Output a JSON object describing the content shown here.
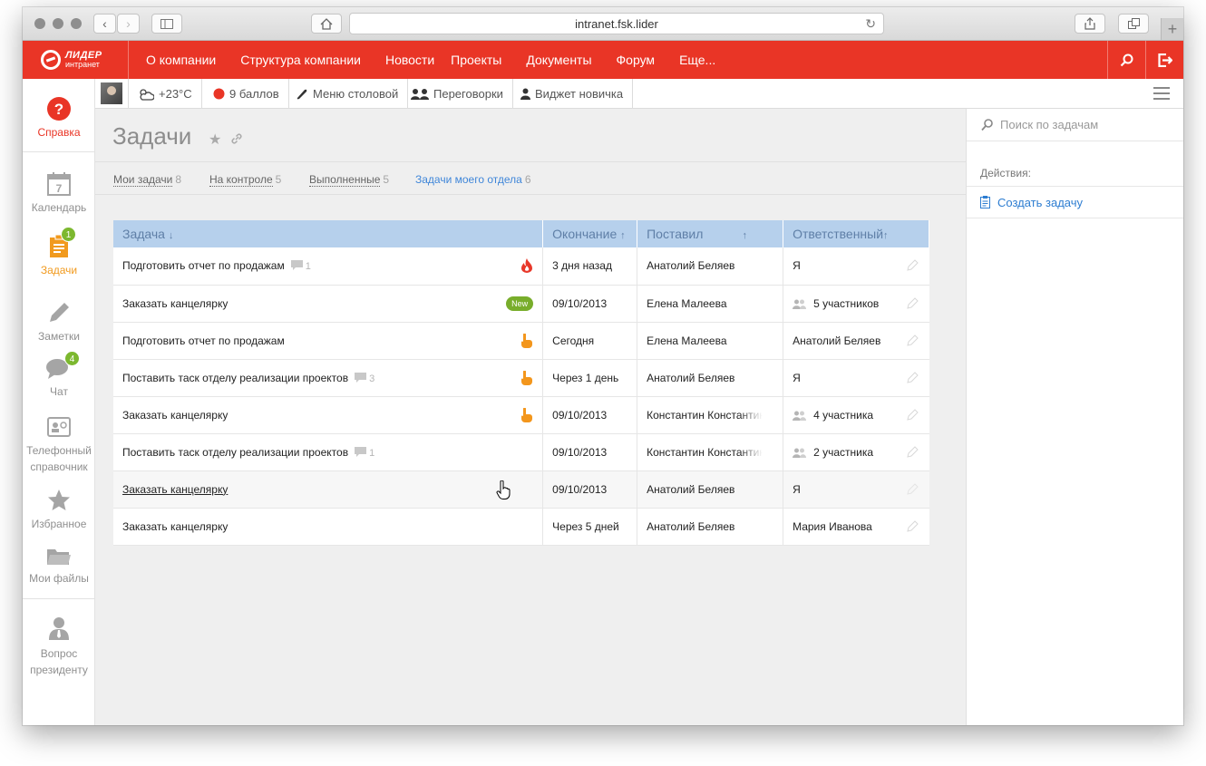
{
  "browser": {
    "url": "intranet.fsk.lider"
  },
  "brand": {
    "name": "ЛИДЕР",
    "subtitle": "интранет",
    "accent_color": "#e93526"
  },
  "topnav": {
    "items": [
      "О компании",
      "Структура компании",
      "Новости",
      "Проекты",
      "Документы",
      "Форум",
      "Еще..."
    ]
  },
  "sidebar": {
    "items": [
      {
        "label": "Справка",
        "icon": "help-icon"
      },
      {
        "label": "Календарь",
        "icon": "calendar-icon",
        "day": "7"
      },
      {
        "label": "Задачи",
        "icon": "tasks-icon",
        "badge": "1"
      },
      {
        "label": "Заметки",
        "icon": "pencil-icon"
      },
      {
        "label": "Чат",
        "icon": "chat-icon",
        "badge": "4"
      },
      {
        "label_line1": "Телефонный",
        "label_line2": "справочник",
        "icon": "phonebook-icon"
      },
      {
        "label": "Избранное",
        "icon": "star-icon"
      },
      {
        "label": "Мои файлы",
        "icon": "folder-icon"
      },
      {
        "label_line1": "Вопрос",
        "label_line2": "президенту",
        "icon": "president-icon"
      }
    ]
  },
  "widgets": {
    "weather": "+23°C",
    "points": "9 баллов",
    "menu": "Меню столовой",
    "meetings": "Переговорки",
    "newbie": "Виджет новичка"
  },
  "page": {
    "title": "Задачи"
  },
  "tabs": [
    {
      "label": "Мои задачи",
      "count": "8"
    },
    {
      "label": "На контроле",
      "count": "5"
    },
    {
      "label": "Выполненные",
      "count": "5"
    },
    {
      "label": "Задачи моего отдела",
      "count": "6"
    }
  ],
  "table": {
    "headers": {
      "task": "Задача",
      "task_sort": "↓",
      "deadline": "Окончание",
      "deadline_sort": "↑",
      "author": "Поставил",
      "author_sort": "↑",
      "responsible": "Ответственный",
      "responsible_sort": "↑"
    },
    "rows": [
      {
        "task": "Подготовить отчет по продажам",
        "comments": "1",
        "flag": "fire-icon",
        "deadline": "3 дня назад",
        "author": "Анатолий Беляев",
        "responsible": "Я"
      },
      {
        "task": "Заказать канцелярку",
        "badge": "New",
        "deadline": "09/10/2013",
        "author": "Елена Малеева",
        "responsible": "5 участников"
      },
      {
        "task": "Подготовить отчет по продажам",
        "flag": "hand-icon",
        "deadline": "Сегодня",
        "author": "Елена Малеева",
        "responsible": "Анатолий Беляев"
      },
      {
        "task": "Поставить таск отделу реализации проектов",
        "comments": "3",
        "flag": "hand-icon",
        "deadline": "Через 1 день",
        "author": "Анатолий Беляев",
        "responsible": "Я"
      },
      {
        "task": "Заказать канцелярку",
        "flag": "hand-icon",
        "deadline": "09/10/2013",
        "author": "Константин Константинов",
        "responsible": "4 участника"
      },
      {
        "task": "Поставить таск отделу реализации проектов",
        "comments": "1",
        "deadline": "09/10/2013",
        "author": "Константин Константинов",
        "responsible": "2 участника"
      },
      {
        "task": "Заказать канцелярку",
        "deadline": "09/10/2013",
        "author": "Анатолий Беляев",
        "responsible": "Я"
      },
      {
        "task": "Заказать канцелярку",
        "deadline": "Через 5 дней",
        "author": "Анатолий Беляев",
        "responsible": "Мария Иванова"
      }
    ]
  },
  "right": {
    "search_placeholder": "Поиск по задачам",
    "actions_label": "Действия:",
    "create_task": "Создать задачу"
  }
}
